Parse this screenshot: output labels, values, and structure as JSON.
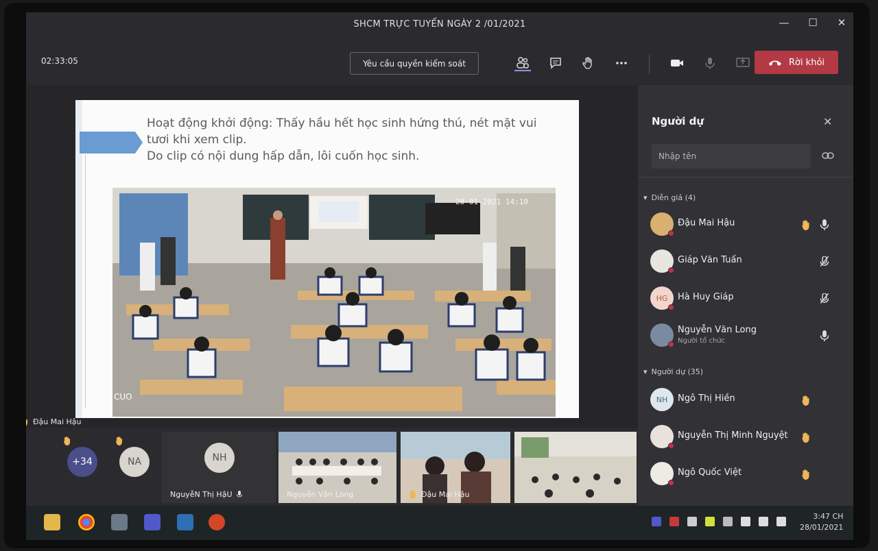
{
  "window": {
    "title": "SHCM TRỰC TUYẾN NGÀY 2 /01/2021",
    "controls": [
      "—",
      "☐",
      "✕"
    ]
  },
  "toolbar": {
    "timer": "02:33:05",
    "request_control": "Yêu cầu quyền kiểm soát",
    "leave_label": "Rời khỏi",
    "icons": [
      "people-icon",
      "chat-icon",
      "raise-hand-icon",
      "more-icon",
      "camera-icon",
      "mic-icon",
      "share-icon"
    ]
  },
  "slide": {
    "lines": [
      "Hoạt động khởi động: Thấy hầu hết học sinh hứng thú, nét mặt vui",
      "tươi khi xem clip.",
      "Do clip có nội dung hấp dẫn, lôi cuốn học sinh."
    ],
    "video_timestamp": "28-01-2021 14:10",
    "corner_text": "CUO"
  },
  "presenter": {
    "name": "Đậu Mai Hậu"
  },
  "strip": {
    "overflow_count": "+34",
    "tiles": [
      {
        "initials": "NA",
        "name": ""
      },
      {
        "initials": "NH",
        "name": "NguyễN Thị HậU"
      },
      {
        "name": "Nguyễn Văn Long"
      },
      {
        "name": "Đậu Mai Hậu"
      },
      {
        "name": ""
      }
    ]
  },
  "panel": {
    "title": "Người dự",
    "search_placeholder": "Nhập tên",
    "presenters_header": "Diễn giả (4)",
    "attendees_header": "Người dự (35)",
    "presenters": [
      {
        "name": "Đậu Mai Hậu",
        "initials": "",
        "sub": ""
      },
      {
        "name": "Giáp Văn Tuấn",
        "initials": "",
        "sub": ""
      },
      {
        "name": "Hà Huy Giáp",
        "initials": "HG",
        "sub": ""
      },
      {
        "name": "Nguyễn Văn Long",
        "initials": "",
        "sub": "Người tổ chức"
      }
    ],
    "attendees": [
      {
        "name": "Ngô Thị Hiền",
        "initials": "NH"
      },
      {
        "name": "Nguyễn Thị Minh Nguyệt",
        "initials": ""
      },
      {
        "name": "Ngô Quốc Việt",
        "initials": ""
      }
    ]
  },
  "taskbar": {
    "time": "3:47 CH",
    "date": "28/01/2021"
  },
  "colors": {
    "leave": "#b33a44",
    "accent": "#8f93f0",
    "raise_hand": "#f0b45a",
    "slide_arrow": "#6a9bd2"
  }
}
